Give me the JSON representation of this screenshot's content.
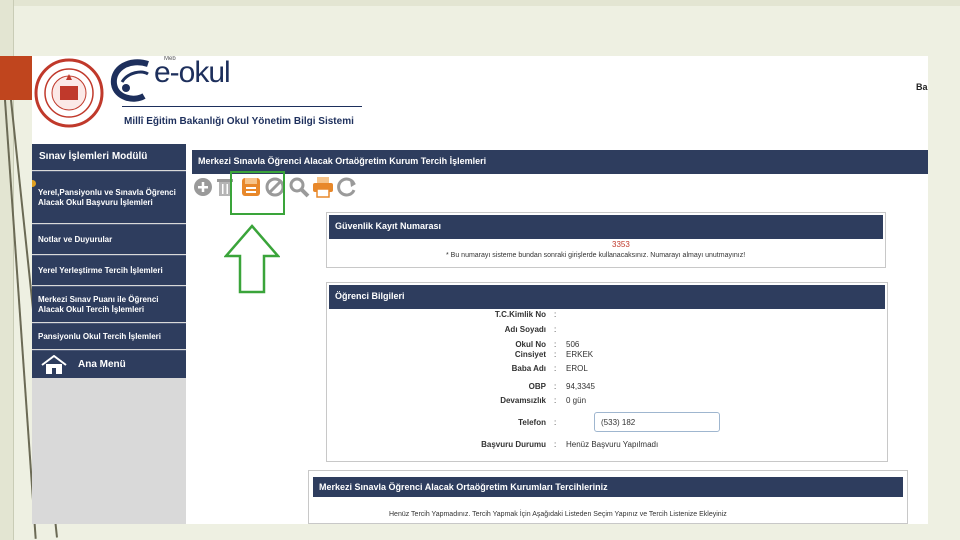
{
  "header": {
    "logo_badge": "Meb",
    "logo_text": "e-okul",
    "system_title": "Millî Eğitim Bakanlığı Okul Yönetim Bilgi Sistemi",
    "right_cut_text": "Ba"
  },
  "sidebar": {
    "title": "Sınav İşlemleri Modülü",
    "items": [
      {
        "label": "Yerel,Pansiyonlu ve Sınavla Öğrenci Alacak Okul Başvuru İşlemleri"
      },
      {
        "label": "Notlar ve Duyurular"
      },
      {
        "label": "Yerel Yerleştirme Tercih İşlemleri"
      },
      {
        "label": "Merkezi Sınav Puanı ile Öğrenci Alacak Okul Tercih İşlemleri"
      },
      {
        "label": "Pansiyonlu Okul Tercih İşlemleri"
      }
    ],
    "home_label": "Ana Menü"
  },
  "content": {
    "bar_title": "Merkezi Sınavla Öğrenci Alacak Ortaöğretim Kurum Tercih İşlemleri"
  },
  "toolbar": {
    "icons": [
      "add-icon",
      "delete-icon",
      "save-icon",
      "cancel-icon",
      "search-icon",
      "print-icon",
      "refresh-icon"
    ]
  },
  "security": {
    "title": "Güvenlik Kayıt Numarası",
    "number": "3353",
    "note": "* Bu numarayı sisteme bundan sonraki girişlerde kullanacaksınız. Numarayı almayı unutmayınız!"
  },
  "student": {
    "title": "Öğrenci Bilgileri",
    "fields": [
      {
        "label": "T.C.Kimlik No",
        "colon": ":",
        "value": ""
      },
      {
        "label": "Adı Soyadı",
        "colon": ":",
        "value": ""
      },
      {
        "label": "Okul No",
        "colon": ":",
        "value": "506"
      },
      {
        "label": "Cinsiyet",
        "colon": ":",
        "value": "ERKEK"
      },
      {
        "label": "Baba Adı",
        "colon": ":",
        "value": "EROL"
      },
      {
        "label": "OBP",
        "colon": ":",
        "value": "94,3345"
      },
      {
        "label": "Devamsızlık",
        "colon": ":",
        "value": "0 gün"
      },
      {
        "label": "Telefon",
        "colon": ":",
        "value": ""
      },
      {
        "label": "Başvuru Durumu",
        "colon": ":",
        "value": "Henüz Başvuru Yapılmadı"
      }
    ],
    "phone_value": "(533) 182"
  },
  "preferences": {
    "title": "Merkezi Sınavla Öğrenci Alacak Ortaöğretim Kurumları Tercihleriniz",
    "note": "Henüz Tercih Yapmadınız. Tercih Yapmak İçin Aşağıdaki Listeden Seçim Yapınız ve Tercih Listenize Ekleyiniz"
  },
  "colors": {
    "nav_bg": "#2e3d5e",
    "highlight": "#3aa43a",
    "accent": "#c0451e",
    "security_number": "#c0392b"
  }
}
